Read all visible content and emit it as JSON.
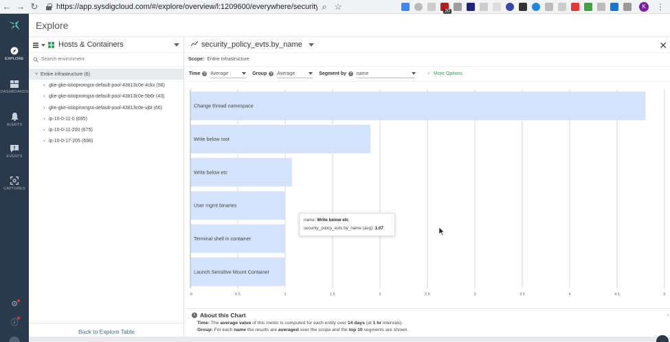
{
  "browser": {
    "url": "https://app.sysdigcloud.com/#/explore/overview/l:1209600/everywhere/security_po...",
    "badge": "20",
    "profile_initial": "K"
  },
  "nav": {
    "items": [
      {
        "label": "EXPLORE",
        "icon": "compass-icon"
      },
      {
        "label": "DASHBOARDS",
        "icon": "dashboard-icon"
      },
      {
        "label": "ALERTS",
        "icon": "bell-icon"
      },
      {
        "label": "EVENTS",
        "icon": "events-icon"
      },
      {
        "label": "CAPTURES",
        "icon": "capture-icon"
      }
    ]
  },
  "page": {
    "title": "Explore"
  },
  "left_panel": {
    "grouping": "Hosts & Containers",
    "search_placeholder": "Search environment",
    "root": "Entire Infrastructure (6)",
    "children": [
      "gke-gke-istiopromgra-default-pool-43813c0e-4ckx (56)",
      "gke-gke-istiopromgra-default-pool-43813c0e-5b6r (43)",
      "gke-gke-istiopromgra-default-pool-43813c0e-vjbl (66)",
      "ip-10-0-11-0 (695)",
      "ip-10-0-11-200 (675)",
      "ip-10-0-17-205 (698)"
    ],
    "back_link": "Back to Explore Table"
  },
  "main": {
    "metric": "security_policy_evts.by_name",
    "scope_label": "Scope:",
    "scope_value": "Entire Infrastructure",
    "time_label": "Time",
    "time_value": "Average",
    "group_label": "Group",
    "group_value": "Average",
    "segment_label": "Segment by",
    "segment_value": "name",
    "more_options": "More Options"
  },
  "tooltip": {
    "name_label": "name:",
    "name_value": "Write below etc",
    "metric_label": "security_policy_evts.by_name (avg):",
    "metric_value": "1.07"
  },
  "about": {
    "title": "About this Chart",
    "time_label": "Time:",
    "time_text_1": "The",
    "time_bold_1": "average value",
    "time_text_2": "of this metric is computed for each entity over",
    "time_bold_2": "14 days",
    "time_text_3": "(at",
    "time_bold_3": "1 hr",
    "time_text_4": "intervals).",
    "group_label": "Group:",
    "group_text_1": "For each",
    "group_bold_1": "name",
    "group_text_2": "the results are",
    "group_bold_2": "averaged",
    "group_text_3": "over the scope and the",
    "group_bold_3": "top 10",
    "group_text_4": "segments are shown."
  },
  "chart_data": {
    "type": "bar",
    "orientation": "horizontal",
    "categories": [
      "Change thread namespace",
      "Write below root",
      "Write below etc",
      "User mgmt binaries",
      "Terminal shell in container",
      "Launch Sensitive Mount Container"
    ],
    "values": [
      4.8,
      1.9,
      1.07,
      1.0,
      1.0,
      1.0
    ],
    "xlim": [
      0,
      5
    ],
    "xticks": [
      "0",
      "0.5",
      "1",
      "1.5",
      "2",
      "2.5",
      "3",
      "3.5",
      "4",
      "4.5",
      "5"
    ],
    "grid": true,
    "bar_color": "#d4e3fb"
  }
}
